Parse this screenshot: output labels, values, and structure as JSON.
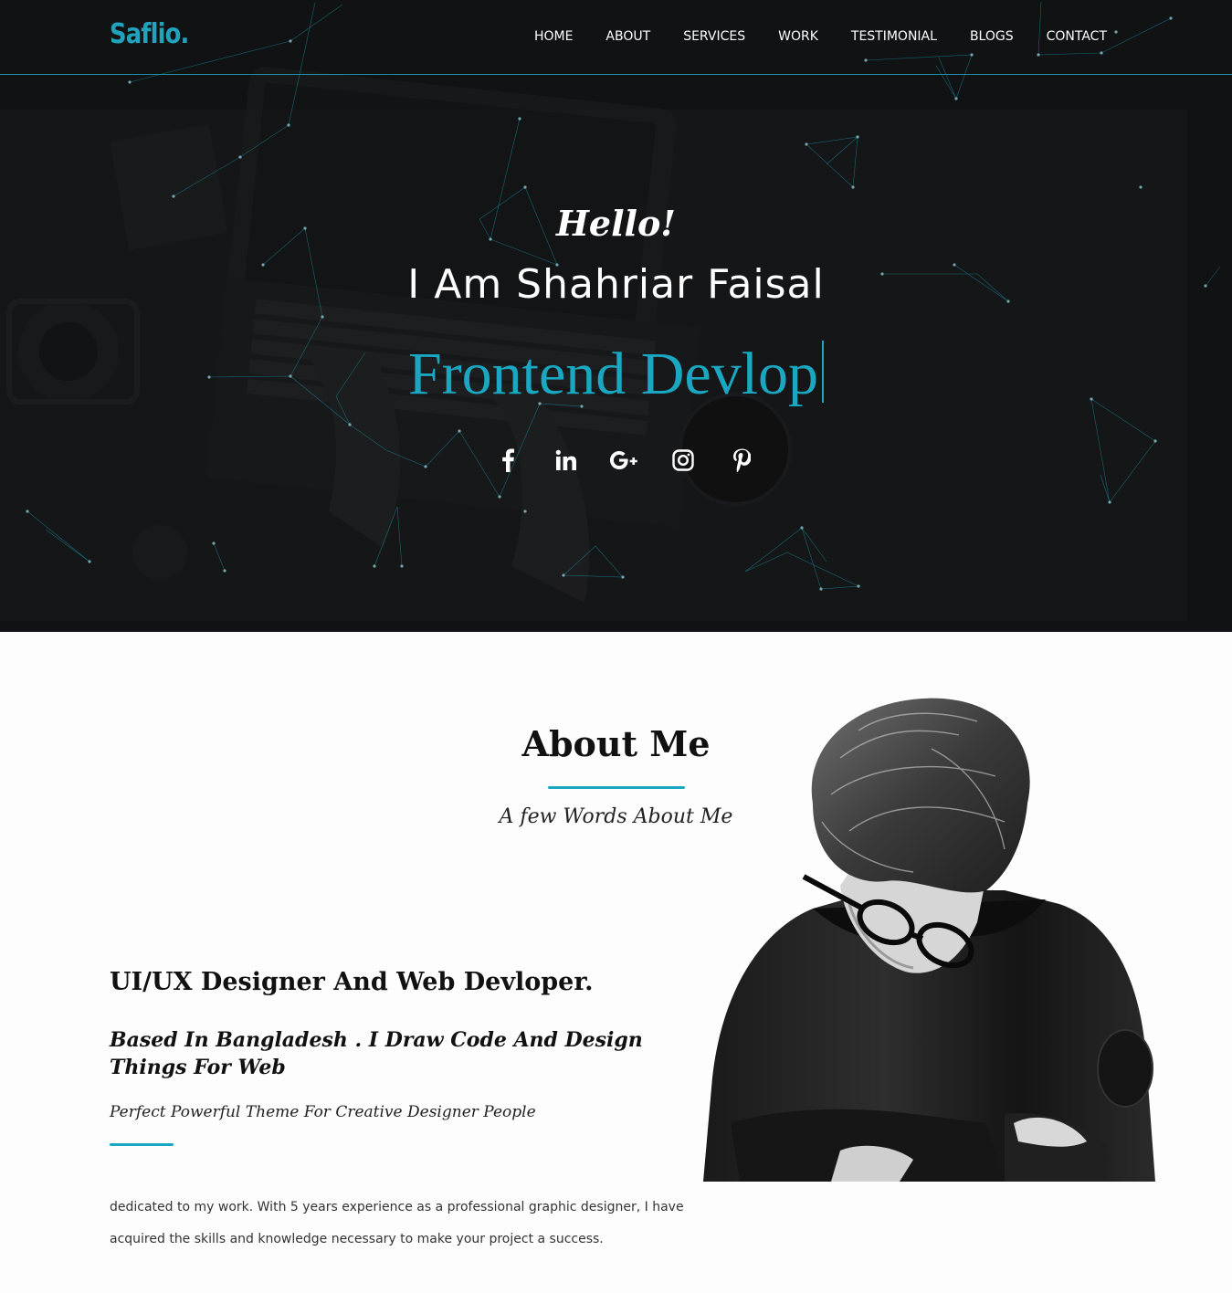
{
  "header": {
    "logo": "Saflio.",
    "nav": [
      "HOME",
      "ABOUT",
      "SERVICES",
      "WORK",
      "TESTIMONIAL",
      "BLOGS",
      "CONTACT"
    ]
  },
  "hero": {
    "greeting": "Hello!",
    "name": "I Am Shahriar Faisal",
    "typed_text": "Frontend Devlop",
    "socials": [
      {
        "icon": "facebook-icon"
      },
      {
        "icon": "linkedin-icon"
      },
      {
        "icon": "google-plus-icon"
      },
      {
        "icon": "instagram-icon"
      },
      {
        "icon": "pinterest-icon"
      }
    ]
  },
  "about": {
    "title": "About Me",
    "subtitle": "A few Words About Me",
    "role": "UI/UX Designer And Web Devloper.",
    "based": "Based In Bangladesh . I Draw Code And Design Things For Web",
    "tagline": "Perfect Powerful Theme For Creative Designer People",
    "paragraph": "dedicated to my work. With 5 years experience as a professional graphic designer, I have acquired the skills and knowledge necessary to make your project a success."
  },
  "colors": {
    "accent": "#1aa7c1",
    "hero_bg": "#101112",
    "page_bg": "#fdfdfd"
  }
}
